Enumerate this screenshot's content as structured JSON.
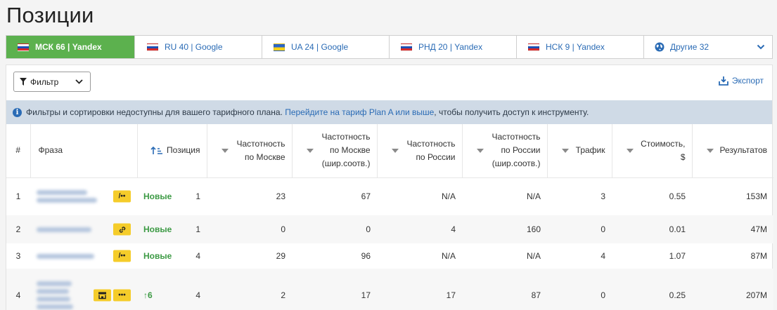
{
  "page_title": "Позиции",
  "tabs": [
    {
      "label": "МСК 66 | Yandex",
      "flag": "ru",
      "active": true
    },
    {
      "label": "RU 40 | Google",
      "flag": "ru",
      "active": false
    },
    {
      "label": "UA 24 | Google",
      "flag": "ua",
      "active": false
    },
    {
      "label": "РНД 20 | Yandex",
      "flag": "ru",
      "active": false
    },
    {
      "label": "НСК 9 | Yandex",
      "flag": "ru",
      "active": false
    },
    {
      "label": "Другие 32",
      "flag": "globe",
      "active": false
    }
  ],
  "toolbar": {
    "filter_label": "Фильтр",
    "export_label": "Экспорт"
  },
  "notice": {
    "text_before": "Фильтры и сортировки недоступны для вашего тарифного плана. ",
    "link": "Перейдите на тариф Plan A или выше",
    "text_after": ", чтобы получить доступ к инструменту."
  },
  "columns": {
    "num": "#",
    "phrase": "Фраза",
    "position": "Позиция",
    "freq_msk_1": "Частотность",
    "freq_msk_2": "по Москве",
    "freq_msk_ex_1": "Частотность",
    "freq_msk_ex_2": "по Москве",
    "freq_msk_ex_3": "(шир.соотв.)",
    "freq_ru_1": "Частотность",
    "freq_ru_2": "по России",
    "freq_ru_ex_1": "Частотность",
    "freq_ru_ex_2": "по России",
    "freq_ru_ex_3": "(шир.соотв.)",
    "traffic": "Трафик",
    "cost_1": "Стоимость,",
    "cost_2": "$",
    "results": "Результатов"
  },
  "rows": [
    {
      "n": "1",
      "pos_status": "Новые",
      "pos": "1",
      "freq_msk": "23",
      "freq_msk_ex": "67",
      "freq_ru": "N/A",
      "freq_ru_ex": "N/A",
      "traffic": "3",
      "cost": "0.55",
      "results": "153M"
    },
    {
      "n": "2",
      "pos_status": "Новые",
      "pos": "1",
      "freq_msk": "0",
      "freq_msk_ex": "0",
      "freq_ru": "4",
      "freq_ru_ex": "160",
      "traffic": "0",
      "cost": "0.01",
      "results": "47M"
    },
    {
      "n": "3",
      "pos_status": "Новые",
      "pos": "4",
      "freq_msk": "29",
      "freq_msk_ex": "96",
      "freq_ru": "N/A",
      "freq_ru_ex": "N/A",
      "traffic": "4",
      "cost": "1.07",
      "results": "87M"
    },
    {
      "n": "4",
      "pos_status": "↑6",
      "pos": "4",
      "freq_msk": "2",
      "freq_msk_ex": "17",
      "freq_ru": "17",
      "freq_ru_ex": "87",
      "traffic": "0",
      "cost": "0.25",
      "results": "207M"
    }
  ],
  "colors": {
    "active_tab": "#5cb14e",
    "link": "#2a6bb5",
    "badge": "#f5cc2a",
    "positive": "#3c9a44",
    "notice_bg": "#cfdae6"
  }
}
